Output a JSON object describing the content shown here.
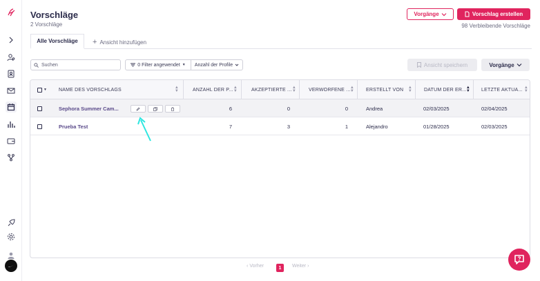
{
  "header": {
    "title": "Vorschläge",
    "subtitle": "2 Vorschläge",
    "vorgaenge_label": "Vorgänge",
    "create_label": "Vorschlag erstellen",
    "remaining": "98 Verbleibende Vorschläge"
  },
  "tabs": {
    "active_label": "Alle Vorschläge",
    "add_label": "Ansicht hinzufügen"
  },
  "toolbar": {
    "search_placeholder": "Suchen",
    "filter_label": "0 Filter angewendet",
    "profiles_label": "Anzahl der Profile",
    "save_view_label": "Ansicht speichern",
    "vorgaenge_label": "Vorgänge"
  },
  "table": {
    "columns": [
      "NAME DES VORSCHLAGS",
      "ANZAHL DER P...",
      "AKZEPTIERTE ...",
      "VERWORFENE ...",
      "ERSTELLT VON",
      "DATUM DER ER...",
      "LETZTE AKTUA..."
    ],
    "rows": [
      {
        "name": "Sephora Summer Cam...",
        "profiles": "6",
        "accepted": "0",
        "rejected": "0",
        "created_by": "Andrea",
        "created_date": "02/03/2025",
        "updated": "02/04/2025"
      },
      {
        "name": "Prueba Test",
        "profiles": "7",
        "accepted": "3",
        "rejected": "1",
        "created_by": "Alejandro",
        "created_date": "01/28/2025",
        "updated": "02/03/2025"
      }
    ]
  },
  "pagination": {
    "prev": "Vorher",
    "current": "1",
    "next": "Weiter"
  },
  "colors": {
    "accent": "#e0245e",
    "annotation_arrow": "#2ee6e0"
  },
  "icons": {
    "sidebar": [
      "logo-icon",
      "chevron-right-icon",
      "user-search-icon",
      "contacts-icon",
      "mail-icon",
      "calendar-icon",
      "chart-icon",
      "wallet-icon",
      "workflow-icon",
      "rocket-icon",
      "settings-icon",
      "user-icon",
      "nike-avatar-icon"
    ],
    "row_actions": [
      "edit-icon",
      "duplicate-icon",
      "delete-icon"
    ]
  }
}
